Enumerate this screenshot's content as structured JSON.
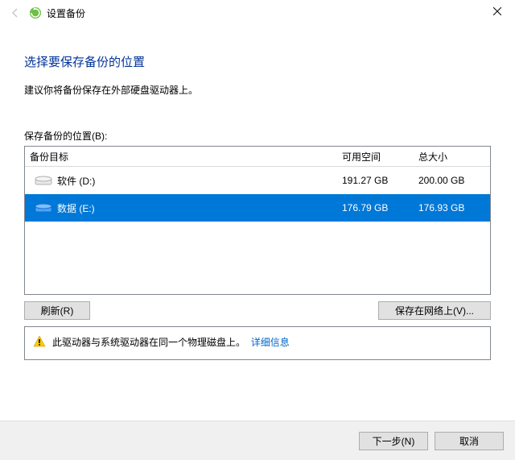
{
  "titlebar": {
    "title": "设置备份"
  },
  "heading": "选择要保存备份的位置",
  "recommendation": "建议你将备份保存在外部硬盘驱动器上。",
  "list_label": "保存备份的位置(B):",
  "columns": {
    "target": "备份目标",
    "free": "可用空间",
    "total": "总大小"
  },
  "drives": [
    {
      "name": "软件 (D:)",
      "free": "191.27 GB",
      "total": "200.00 GB",
      "selected": false
    },
    {
      "name": "数据 (E:)",
      "free": "176.79 GB",
      "total": "176.93 GB",
      "selected": true
    }
  ],
  "buttons": {
    "refresh": "刷新(R)",
    "save_network": "保存在网络上(V)..."
  },
  "warning": {
    "text": "此驱动器与系统驱动器在同一个物理磁盘上。",
    "link": "详细信息"
  },
  "footer": {
    "next": "下一步(N)",
    "cancel": "取消"
  }
}
